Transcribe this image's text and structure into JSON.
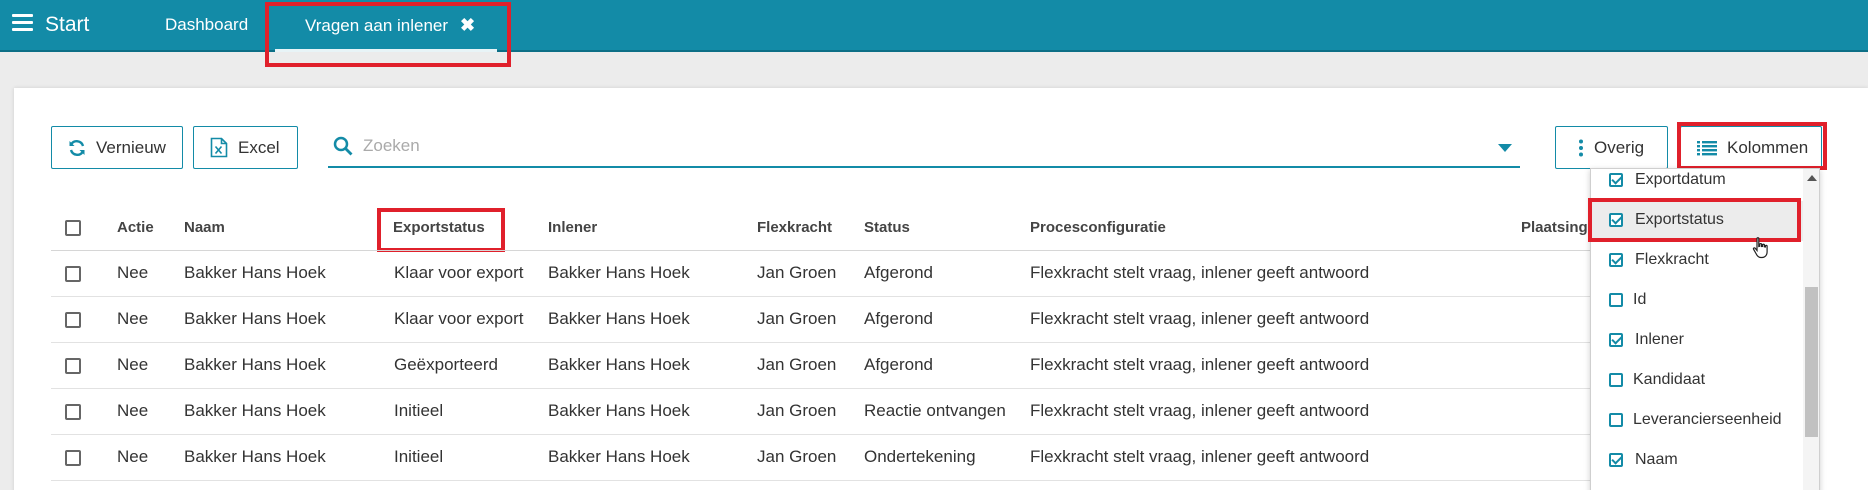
{
  "topbar": {
    "brand": "Start",
    "tabs": [
      {
        "label": "Dashboard"
      },
      {
        "label": "Vragen aan inlener",
        "close": "✖"
      }
    ]
  },
  "toolbar": {
    "refresh_label": "Vernieuw",
    "excel_label": "Excel",
    "search_placeholder": "Zoeken",
    "other_label": "Overig",
    "columns_label": "Kolommen"
  },
  "table": {
    "headers": {
      "actie": "Actie",
      "naam": "Naam",
      "exportstatus": "Exportstatus",
      "inlener": "Inlener",
      "flexkracht": "Flexkracht",
      "status": "Status",
      "procesconfiguratie": "Procesconfiguratie",
      "plaatsing": "Plaatsing"
    },
    "rows": [
      {
        "actie": "Nee",
        "naam": "Bakker Hans Hoek",
        "exportstatus": "Klaar voor export",
        "inlener": "Bakker Hans Hoek",
        "flexkracht": "Jan Groen",
        "status": "Afgerond",
        "procesconfiguratie": "Flexkracht stelt vraag, inlener geeft antwoord"
      },
      {
        "actie": "Nee",
        "naam": "Bakker Hans Hoek",
        "exportstatus": "Klaar voor export",
        "inlener": "Bakker Hans Hoek",
        "flexkracht": "Jan Groen",
        "status": "Afgerond",
        "procesconfiguratie": "Flexkracht stelt vraag, inlener geeft antwoord"
      },
      {
        "actie": "Nee",
        "naam": "Bakker Hans Hoek",
        "exportstatus": "Geëxporteerd",
        "inlener": "Bakker Hans Hoek",
        "flexkracht": "Jan Groen",
        "status": "Afgerond",
        "procesconfiguratie": "Flexkracht stelt vraag, inlener geeft antwoord"
      },
      {
        "actie": "Nee",
        "naam": "Bakker Hans Hoek",
        "exportstatus": "Initieel",
        "inlener": "Bakker Hans Hoek",
        "flexkracht": "Jan Groen",
        "status": "Reactie ontvangen",
        "procesconfiguratie": "Flexkracht stelt vraag, inlener geeft antwoord"
      },
      {
        "actie": "Nee",
        "naam": "Bakker Hans Hoek",
        "exportstatus": "Initieel",
        "inlener": "Bakker Hans Hoek",
        "flexkracht": "Jan Groen",
        "status": "Ondertekening",
        "procesconfiguratie": "Flexkracht stelt vraag, inlener geeft antwoord"
      }
    ]
  },
  "column_menu": {
    "items": [
      {
        "label": "Exportdatum",
        "checked": true
      },
      {
        "label": "Exportstatus",
        "checked": true
      },
      {
        "label": "Flexkracht",
        "checked": true
      },
      {
        "label": "Id",
        "checked": false
      },
      {
        "label": "Inlener",
        "checked": true
      },
      {
        "label": "Kandidaat",
        "checked": false
      },
      {
        "label": "Leverancierseenheid",
        "checked": false
      },
      {
        "label": "Naam",
        "checked": true
      }
    ]
  },
  "colors": {
    "accent": "#138ba7",
    "highlight": "#e0202b"
  }
}
